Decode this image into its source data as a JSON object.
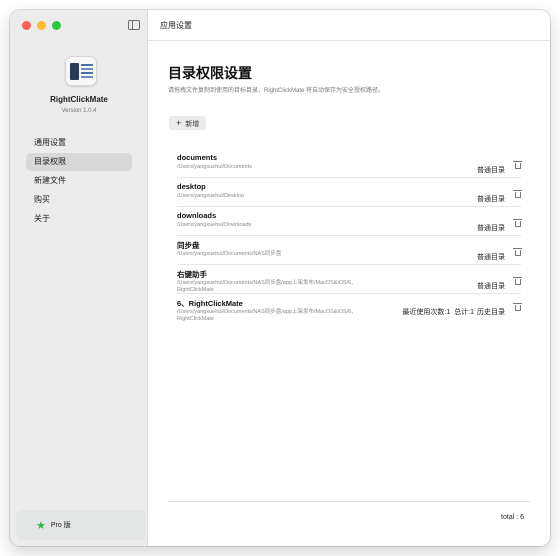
{
  "window": {
    "title": "应用设置"
  },
  "sidebar": {
    "app_name": "RightClickMate",
    "version": "Version 1.0.4",
    "items": [
      {
        "label": "通用设置",
        "active": false
      },
      {
        "label": "目录权限",
        "active": true
      },
      {
        "label": "新建文件",
        "active": false
      },
      {
        "label": "购买",
        "active": false
      },
      {
        "label": "关于",
        "active": false
      }
    ],
    "pro_label": "Pro 版"
  },
  "main": {
    "title": "目录权限设置",
    "description": "请拖拽文件复制到使用的目标目录，RightClickMate 将自动保存为安全授权路径。",
    "add_button": "新增",
    "directories": [
      {
        "name": "documents",
        "path": "/Users/yangxuehui/Documents",
        "type": "普通目录"
      },
      {
        "name": "desktop",
        "path": "/Users/yangxuehui/Desktop",
        "type": "普通目录"
      },
      {
        "name": "downloads",
        "path": "/Users/yangxuehui/Downloads",
        "type": "普通目录"
      },
      {
        "name": "同步盘",
        "path": "/Users/yangxuehui/Documents/NAS同步盘",
        "type": "普通目录"
      },
      {
        "name": "右键助手",
        "path": "/Users/yangxuehui/Documents/NAS同步盘/app上架发布/MacOS&iOS/6、RightClickMate",
        "type": "普通目录"
      },
      {
        "name": "6、RightClickMate",
        "path": "/Users/yangxuehui/Documents/NAS同步盘/app上架发布/MacOS&iOS/6、RightClickMate",
        "type": "历史目录",
        "recent_use": "最近使用次数:1",
        "total_count": "总计:1"
      }
    ],
    "total": "total : 6"
  },
  "colors": {
    "accent_green": "#2bb34a",
    "sidebar_bg": "#ececec",
    "active_item": "#d8d8d8"
  },
  "icons": {
    "sidebar_toggle": "sidebar-toggle-icon",
    "add": "plus-icon",
    "delete": "trash-icon",
    "pro": "star-icon"
  }
}
